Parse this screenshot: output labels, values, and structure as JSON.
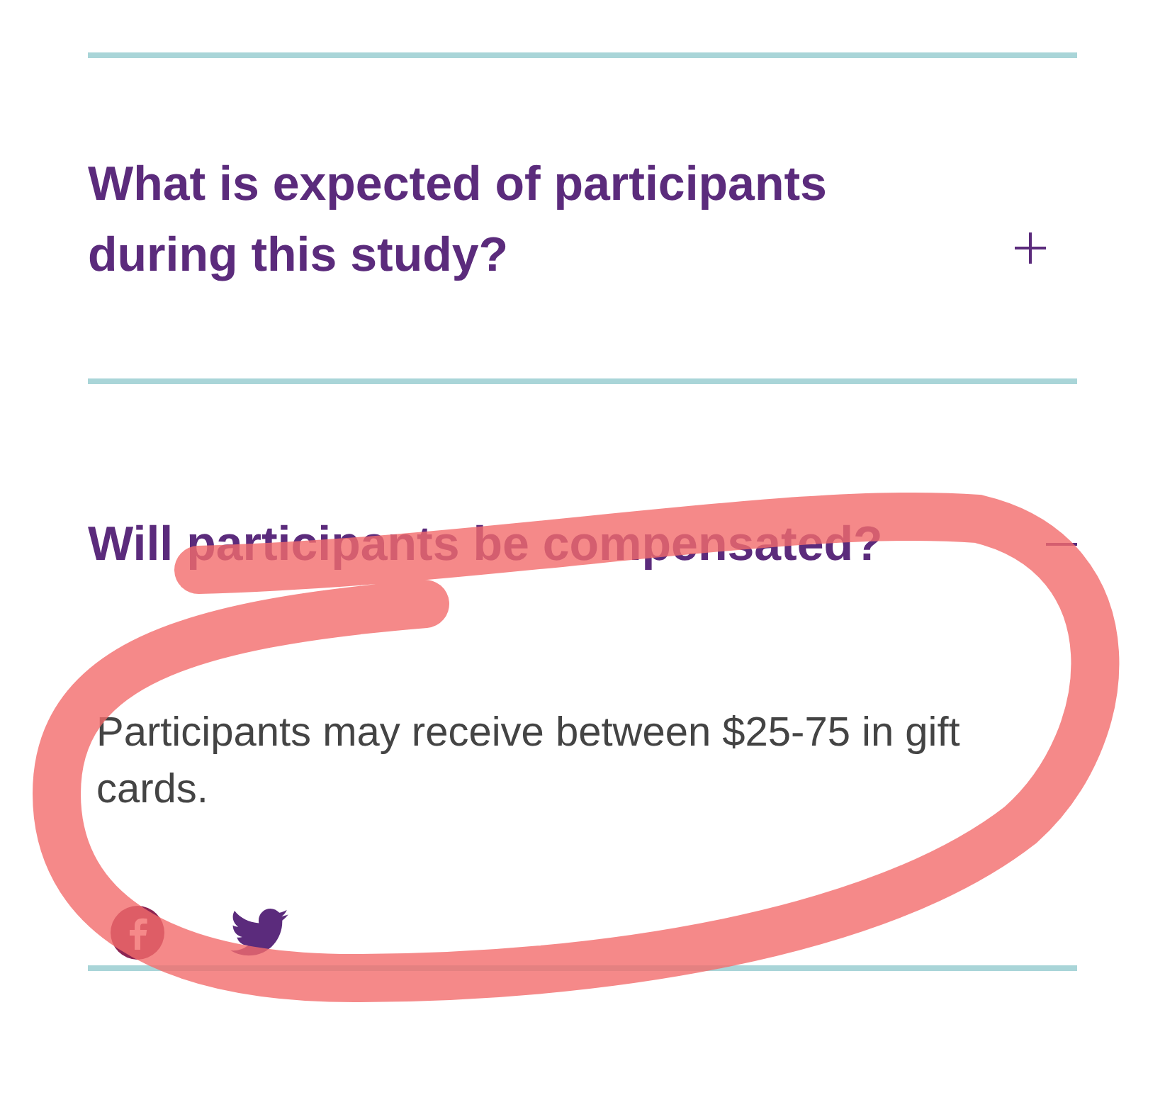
{
  "faq": [
    {
      "question": "What is expected of participants during this study?",
      "expanded": false
    },
    {
      "question": "Will participants be compensated?",
      "expanded": true,
      "answer": "Participants may receive between $25-75 in gift cards."
    }
  ]
}
